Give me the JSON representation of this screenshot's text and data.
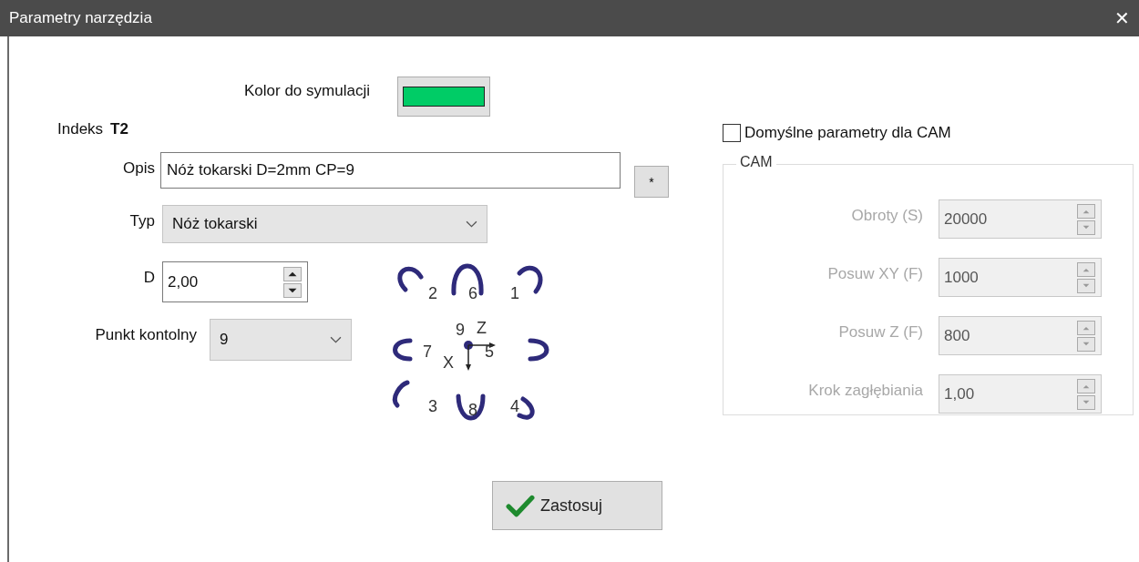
{
  "window": {
    "title": "Parametry narzędzia",
    "close": "✕"
  },
  "color_label": "Kolor do symulacji",
  "color": "#00cc66",
  "index": {
    "label": "Indeks",
    "value": "T2"
  },
  "description": {
    "label": "Opis",
    "value": "Nóż tokarski D=2mm CP=9",
    "button": "*"
  },
  "type": {
    "label": "Typ",
    "value": "Nóż tokarski"
  },
  "diameter": {
    "label": "D",
    "value": "2,00"
  },
  "control_point": {
    "label": "Punkt kontolny",
    "value": "9"
  },
  "diagram": {
    "labels": [
      "2",
      "6",
      "1",
      "7",
      "9",
      "Z",
      "5",
      "X",
      "3",
      "8",
      "4"
    ]
  },
  "cam_default": {
    "label": "Domyślne parametry dla CAM",
    "checked": false
  },
  "cam": {
    "title": "CAM",
    "disabled": true,
    "fields": [
      {
        "label": "Obroty (S)",
        "value": "20000"
      },
      {
        "label": "Posuw XY (F)",
        "value": "1000"
      },
      {
        "label": "Posuw Z (F)",
        "value": "800"
      },
      {
        "label": "Krok zagłębiania",
        "value": "1,00"
      }
    ]
  },
  "apply_button": "Zastosuj"
}
